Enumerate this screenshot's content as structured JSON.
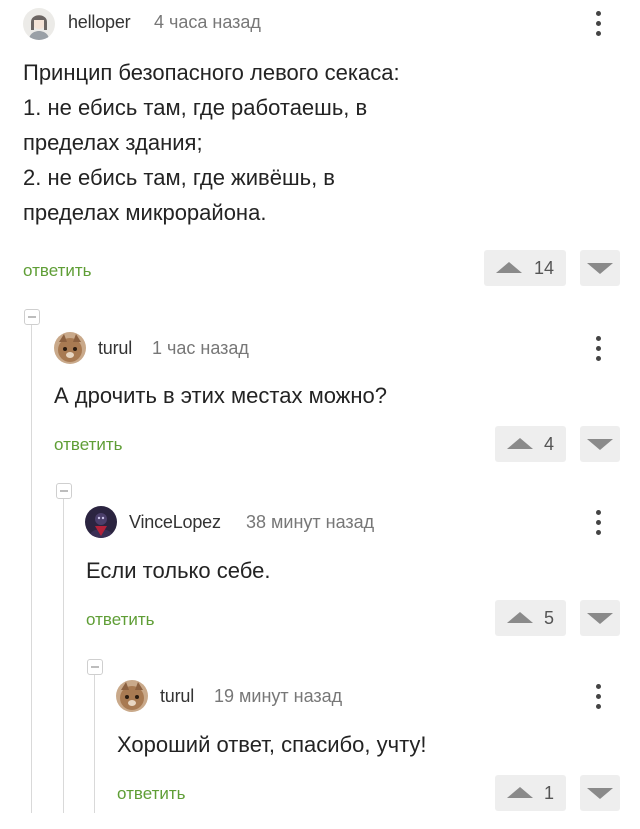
{
  "comments": [
    {
      "author": "helloper",
      "time": "4 часа назад",
      "lines": [
        "Принцип безопасного левого секаса:",
        "1. не ебись там, где работаешь, в",
        "пределах здания;",
        "2. не ебись там, где живёшь, в",
        "пределах микрорайона."
      ],
      "reply_label": "ответить",
      "rating": "14",
      "avatar_icon": "girl-avatar-icon"
    },
    {
      "author": "turul",
      "time": "1 час назад",
      "lines": [
        "А дрочить в этих местах можно?"
      ],
      "reply_label": "ответить",
      "rating": "4",
      "avatar_icon": "cat-avatar-icon"
    },
    {
      "author": "VinceLopez",
      "time": "38 минут назад",
      "lines": [
        "Если только себе."
      ],
      "reply_label": "ответить",
      "rating": "5",
      "avatar_icon": "dark-hero-avatar-icon"
    },
    {
      "author": "turul",
      "time": "19 минут назад",
      "lines": [
        "Хороший ответ, спасибо, учту!"
      ],
      "reply_label": "ответить",
      "rating": "1",
      "avatar_icon": "cat-avatar-icon"
    }
  ],
  "colors": {
    "reply_link": "#5f9e36",
    "vote_bg": "#eeeeee",
    "thread_line": "#d9d9d9"
  }
}
